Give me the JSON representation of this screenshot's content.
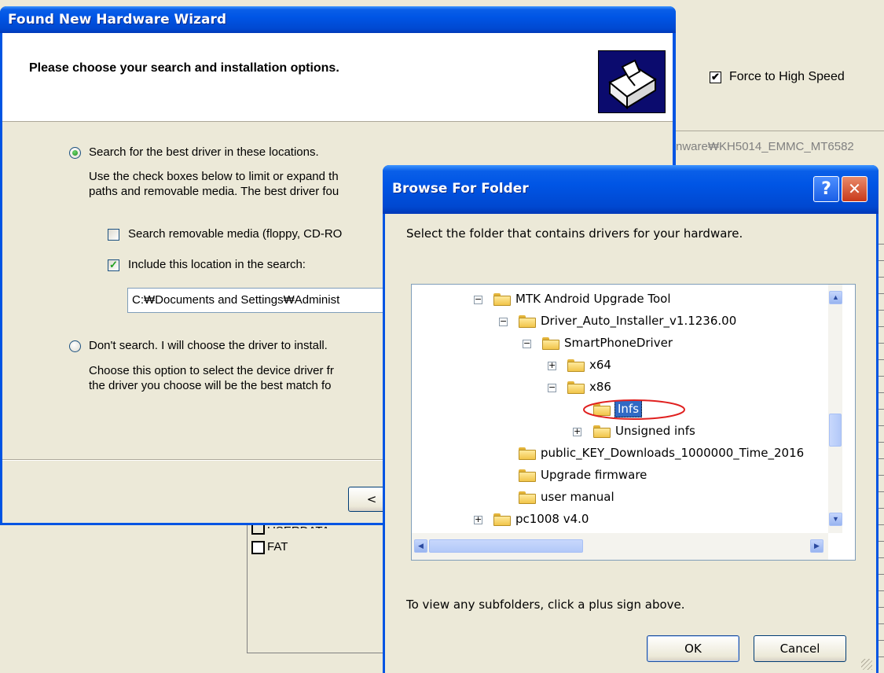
{
  "background_window": {
    "force_label": "Force to High Speed",
    "path_fragment": "nware₩KH5014_EMMC_MT6582",
    "userdata_label": "USERDATA",
    "fat_label": "FAT"
  },
  "wizard": {
    "title": "Found New Hardware Wizard",
    "heading": "Please choose your search and installation options.",
    "option_search_label": "Search for the best driver in these locations.",
    "search_desc_1": "Use the check boxes below to limit or expand th",
    "search_desc_2": "paths and removable media. The best driver fou",
    "removable_label": "Search removable media (floppy, CD-RO",
    "include_label": "Include this location in the search:",
    "location_value": "C:₩Documents and Settings₩Administ",
    "option_dont_label": "Don't search. I will choose the driver to install.",
    "dont_desc_1": "Choose this option to select the device driver fr",
    "dont_desc_2": "the driver you choose will be the best match fo",
    "back_label": "<"
  },
  "browse": {
    "title": "Browse For Folder",
    "help_label": "?",
    "close_label": "✕",
    "instruction": "Select the folder that contains drivers for your hardware.",
    "hint": "To view any subfolders, click a plus sign above.",
    "ok_label": "OK",
    "cancel_label": "Cancel",
    "tree": [
      {
        "label": "MTK Android Upgrade Tool",
        "expander": "−",
        "level": 0
      },
      {
        "label": "Driver_Auto_Installer_v1.1236.00",
        "expander": "−",
        "level": 1
      },
      {
        "label": "SmartPhoneDriver",
        "expander": "−",
        "level": 2
      },
      {
        "label": "x64",
        "expander": "+",
        "level": 3
      },
      {
        "label": "x86",
        "expander": "−",
        "level": 3
      },
      {
        "label": "Infs",
        "expander": "",
        "level": 4,
        "selected": true
      },
      {
        "label": "Unsigned infs",
        "expander": "+",
        "level": 4
      },
      {
        "label": "public_KEY_Downloads_1000000_Time_2016",
        "expander": "",
        "level": 1
      },
      {
        "label": "Upgrade firmware",
        "expander": "",
        "level": 1
      },
      {
        "label": "user manual",
        "expander": "",
        "level": 1
      },
      {
        "label": "pc1008 v4.0",
        "expander": "+",
        "level": 0
      }
    ]
  },
  "colors": {
    "xp_blue": "#0054e3",
    "selection": "#316ac5",
    "annotation": "#e0201f"
  }
}
